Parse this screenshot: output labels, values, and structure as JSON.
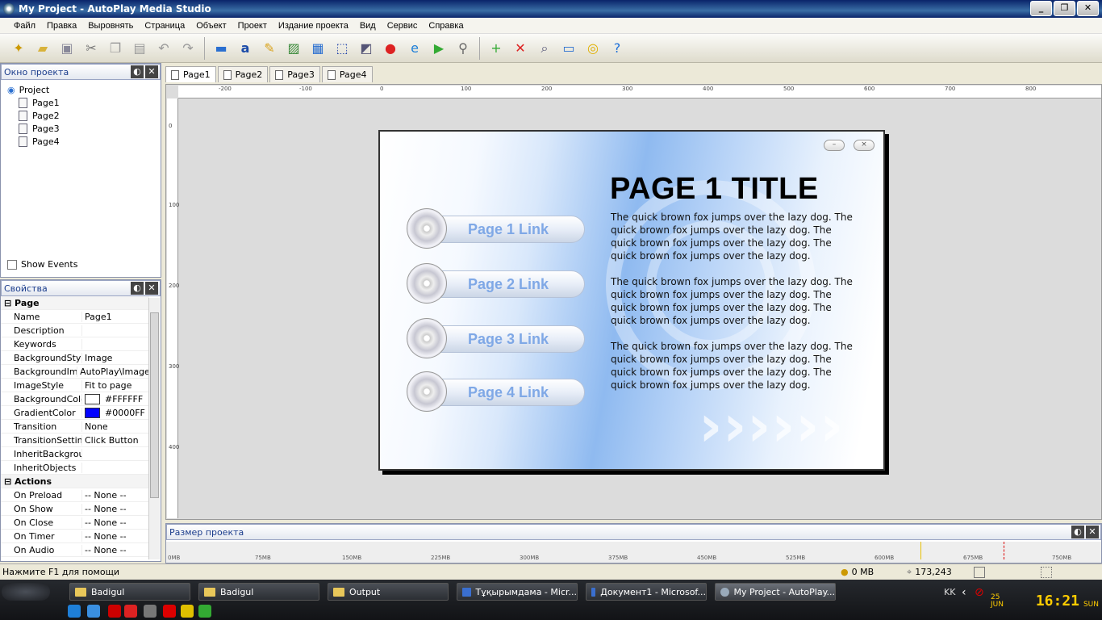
{
  "window": {
    "title": "My Project - AutoPlay Media Studio"
  },
  "menu": [
    "Файл",
    "Правка",
    "Выровнять",
    "Страница",
    "Объект",
    "Проект",
    "Издание проекта",
    "Вид",
    "Сервис",
    "Справка"
  ],
  "project_panel": {
    "title": "Окно проекта",
    "root": "Project",
    "pages": [
      "Page1",
      "Page2",
      "Page3",
      "Page4"
    ],
    "show_events": "Show Events"
  },
  "properties_panel": {
    "title": "Свойства",
    "section_page": "Page",
    "rows": [
      {
        "k": "Name",
        "v": "Page1"
      },
      {
        "k": "Description",
        "v": ""
      },
      {
        "k": "Keywords",
        "v": ""
      },
      {
        "k": "BackgroundStyle",
        "v": "Image"
      },
      {
        "k": "BackgroundImage",
        "v": "AutoPlay\\Images"
      },
      {
        "k": "ImageStyle",
        "v": "Fit to page"
      }
    ],
    "bgcolor": {
      "k": "BackgroundColor",
      "v": "#FFFFFF"
    },
    "gradcolor": {
      "k": "GradientColor",
      "v": "#0000FF"
    },
    "rows2": [
      {
        "k": "Transition",
        "v": "None"
      },
      {
        "k": "TransitionSettings",
        "v": "Click Button"
      },
      {
        "k": "InheritBackground",
        "v": ""
      },
      {
        "k": "InheritObjects",
        "v": ""
      }
    ],
    "section_actions": "Actions",
    "actions": [
      {
        "k": "On Preload",
        "v": "-- None --"
      },
      {
        "k": "On Show",
        "v": "-- None --"
      },
      {
        "k": "On Close",
        "v": "-- None --"
      },
      {
        "k": "On Timer",
        "v": "-- None --"
      },
      {
        "k": "On Audio",
        "v": "-- None --"
      }
    ]
  },
  "tabs": [
    "Page1",
    "Page2",
    "Page3",
    "Page4"
  ],
  "ruler_h": [
    "-200",
    "-100",
    "0",
    "100",
    "200",
    "300",
    "400",
    "500",
    "600",
    "700",
    "800"
  ],
  "ruler_v": [
    "0",
    "100",
    "200",
    "300",
    "400"
  ],
  "page": {
    "title": "PAGE 1 TITLE",
    "links": [
      "Page 1 Link",
      "Page 2 Link",
      "Page 3 Link",
      "Page 4 Link"
    ],
    "paragraphs": [
      "The quick brown fox jumps over the lazy dog. The quick brown fox jumps over the lazy dog. The quick brown fox jumps over the lazy dog. The quick brown fox jumps over the lazy dog.",
      "The quick brown fox jumps over the lazy dog. The quick brown fox jumps over the lazy dog. The quick brown fox jumps over the lazy dog. The quick brown fox jumps over the lazy dog.",
      "The quick brown fox jumps over the lazy dog. The quick brown fox jumps over the lazy dog. The quick brown fox jumps over the lazy dog. The quick brown fox jumps over the lazy dog."
    ]
  },
  "size_panel": {
    "title": "Размер проекта",
    "marks": [
      "0MB",
      "75MB",
      "150MB",
      "225MB",
      "300MB",
      "375MB",
      "450MB",
      "525MB",
      "600MB",
      "675MB",
      "750MB"
    ]
  },
  "status": {
    "help": "Нажмите F1 для помощи",
    "size": "0 MB",
    "coords": "173,243"
  },
  "taskbar": {
    "tasks": [
      "Badigul",
      "Badigul",
      "Output",
      "Тұқырымдама - Micr...",
      "Документ1 - Microsof...",
      "My Project - AutoPlay..."
    ],
    "lang": "KK",
    "date": "25 JUN",
    "time": "16:21",
    "day": "SUN"
  },
  "colors": {
    "accent": "#0a246a",
    "page_gradient": "#0000FF",
    "link_text": "#7fa8e6"
  }
}
